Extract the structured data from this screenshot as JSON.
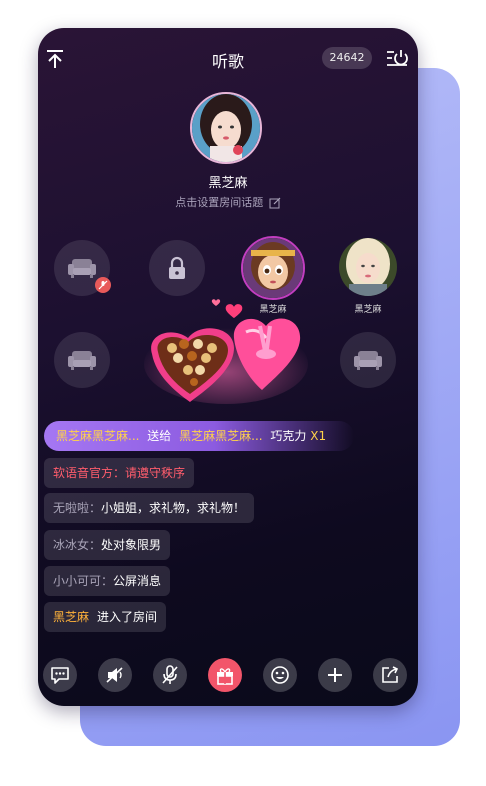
{
  "header": {
    "title": "听歌",
    "online_count": "24642",
    "back_icon": "arrow-up-icon",
    "exit_icon": "power-exit-icon"
  },
  "host": {
    "name": "黑芝麻",
    "topic_placeholder": "点击设置房间话题"
  },
  "seats": {
    "row1": [
      {
        "state": "empty",
        "muted": true
      },
      {
        "state": "locked"
      },
      {
        "state": "occupied",
        "name": "黑芝麻"
      },
      {
        "state": "occupied",
        "name": "黑芝麻"
      }
    ],
    "row2": [
      {
        "state": "empty"
      },
      {
        "state": "gift-animation"
      },
      {
        "state": "gift-animation"
      },
      {
        "state": "empty"
      }
    ]
  },
  "gift_banner": {
    "sender": "黑芝麻黑芝麻...",
    "verb": "送给",
    "receiver": "黑芝麻黑芝麻...",
    "gift": "巧克力",
    "multiplier": "X1"
  },
  "chat": [
    {
      "text": "软语音官方：请遵守秩序",
      "type": "official"
    },
    {
      "user": "无啦啦：",
      "text": "小姐姐，求礼物，求礼物！"
    },
    {
      "user": "冰冰女：",
      "text": "处对象限男"
    },
    {
      "user": "小小可可：",
      "text": "公屏消息"
    },
    {
      "user": "黑芝麻",
      "text": "进入了房间",
      "type": "join"
    }
  ],
  "bottom_bar": [
    "chat-icon",
    "speaker-muted-icon",
    "mic-muted-icon",
    "gift-icon",
    "emoji-icon",
    "plus-icon",
    "share-icon"
  ],
  "colors": {
    "accent_gold": "#ffd24a",
    "official_red": "#ff5d6c",
    "gift_button": "#f2556a",
    "banner_purple": "#a577f3"
  }
}
